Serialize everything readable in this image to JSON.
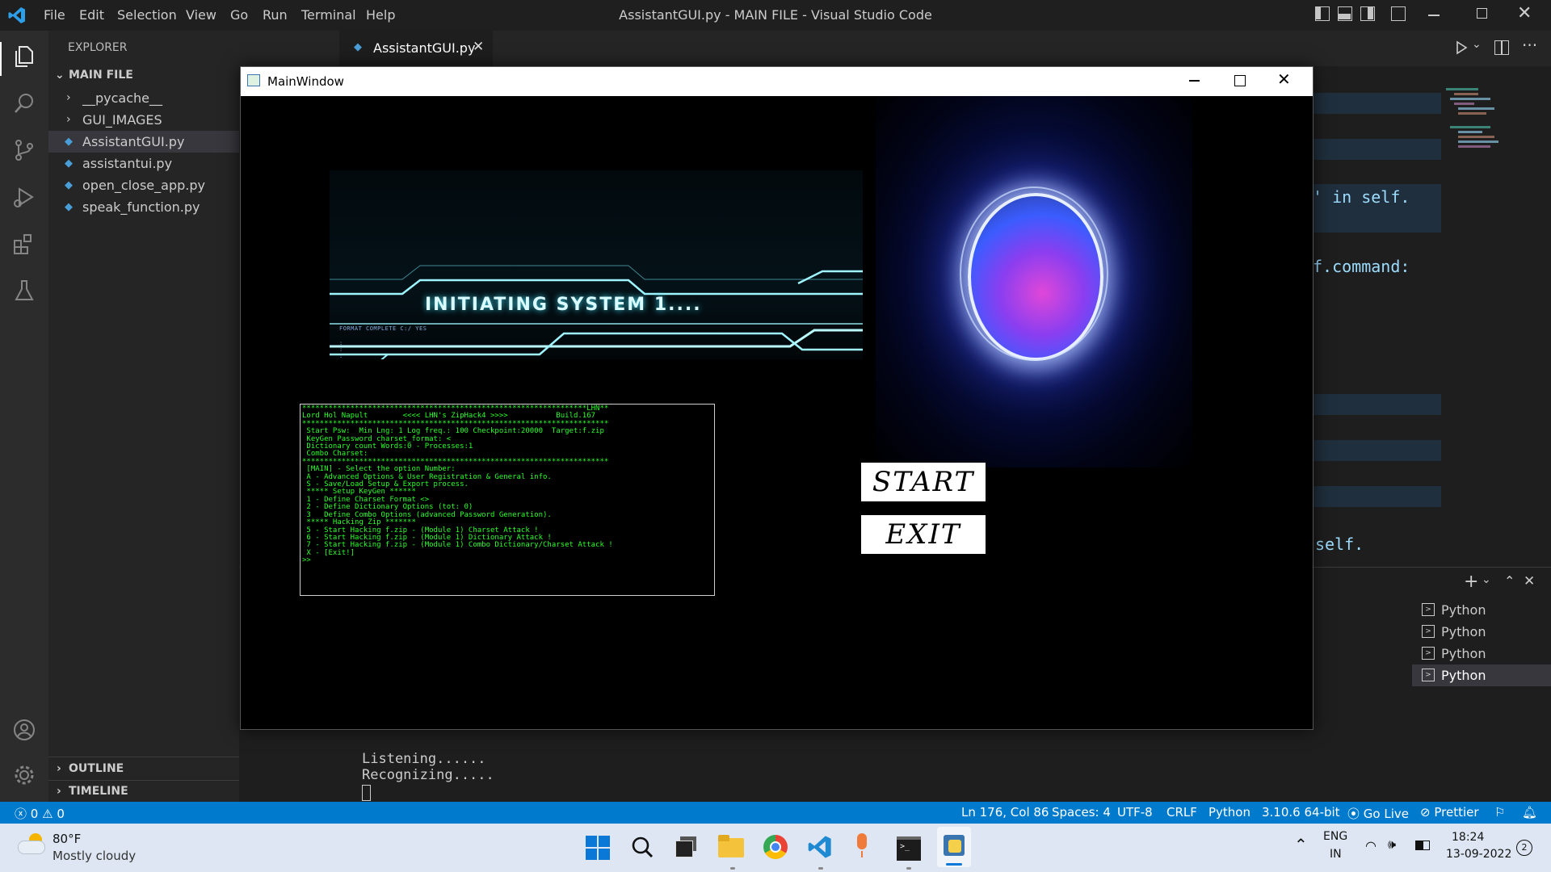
{
  "window_title": "AssistantGUI.py - MAIN FILE - Visual Studio Code",
  "menu": [
    "File",
    "Edit",
    "Selection",
    "View",
    "Go",
    "Run",
    "Terminal",
    "Help"
  ],
  "explorer": {
    "header": "EXPLORER",
    "folder": "MAIN FILE",
    "items": [
      {
        "label": "__pycache__",
        "type": "folder"
      },
      {
        "label": "GUI_IMAGES",
        "type": "folder"
      },
      {
        "label": "AssistantGUI.py",
        "type": "file",
        "selected": true
      },
      {
        "label": "assistantui.py",
        "type": "file"
      },
      {
        "label": "open_close_app.py",
        "type": "file"
      },
      {
        "label": "speak_function.py",
        "type": "file"
      }
    ],
    "outline": "OUTLINE",
    "timeline": "TIMELINE"
  },
  "tab": {
    "label": "AssistantGUI.py"
  },
  "code_fragments": [
    "' in self.",
    "f.command:",
    "self."
  ],
  "terminal": {
    "lines": [
      "Listening......",
      "Recognizing....."
    ],
    "sessions": [
      "Python",
      "Python",
      "Python",
      "Python"
    ]
  },
  "mainwindow": {
    "title": "MainWindow",
    "banner_text": "INITIATING SYSTEM 1....",
    "banner_sub": "FORMAT COMPLETE C:/ YES",
    "console_lines": [
      "*****************************************************************LHN**",
      "Lord Hol Napult        <<<< LHN's ZipHack4 >>>>           Build.167",
      "**********************************************************************",
      " Start Psw:  Min Lng: 1 Log freq.: 100 Checkpoint:20000  Target:f.zip",
      " KeyGen Password charset_format: <",
      " Dictionary count Words:0 - Processes:1",
      " Combo Charset:",
      "**********************************************************************",
      " [MAIN] - Select the option Number:",
      " A - Advanced Options & User Registration & General info.",
      " S - Save/Load Setup & Export process.",
      " ***** Setup KeyGen ******",
      " 1 - Define Charset Format <>",
      " 2 - Define Dictionary Options (tot: 0)",
      " 3   Define Combo Options (advanced Password Generation).",
      " ***** Hacking Zip *******",
      " 5 - Start Hacking f.zip - (Module 1) Charset Attack !",
      " 6 - Start Hacking f.zip - (Module 1) Dictionary Attack !",
      " 7 - Start Hacking f.zip - (Module 1) Combo Dictionary/Charset Attack !",
      " X - [Exit!]",
      ">>"
    ],
    "start_label": "START",
    "exit_label": "EXIT"
  },
  "statusbar": {
    "errors": "0",
    "warnings": "0",
    "position": "Ln 176, Col 86",
    "spaces": "Spaces: 4",
    "encoding": "UTF-8",
    "eol": "CRLF",
    "language": "Python",
    "interpreter": "3.10.6 64-bit",
    "golive": "Go Live",
    "prettier": "Prettier"
  },
  "taskbar": {
    "weather_temp": "80°F",
    "weather_desc": "Mostly cloudy",
    "lang_top": "ENG",
    "lang_bottom": "IN",
    "time": "18:24",
    "date": "13-09-2022",
    "notif_count": "2"
  },
  "colors": {
    "statusbar": "#007acc",
    "terminal_green": "#2bff2b",
    "activity_bar": "#2c2c2c",
    "sidebar": "#252526",
    "editor": "#1e1e1e"
  }
}
